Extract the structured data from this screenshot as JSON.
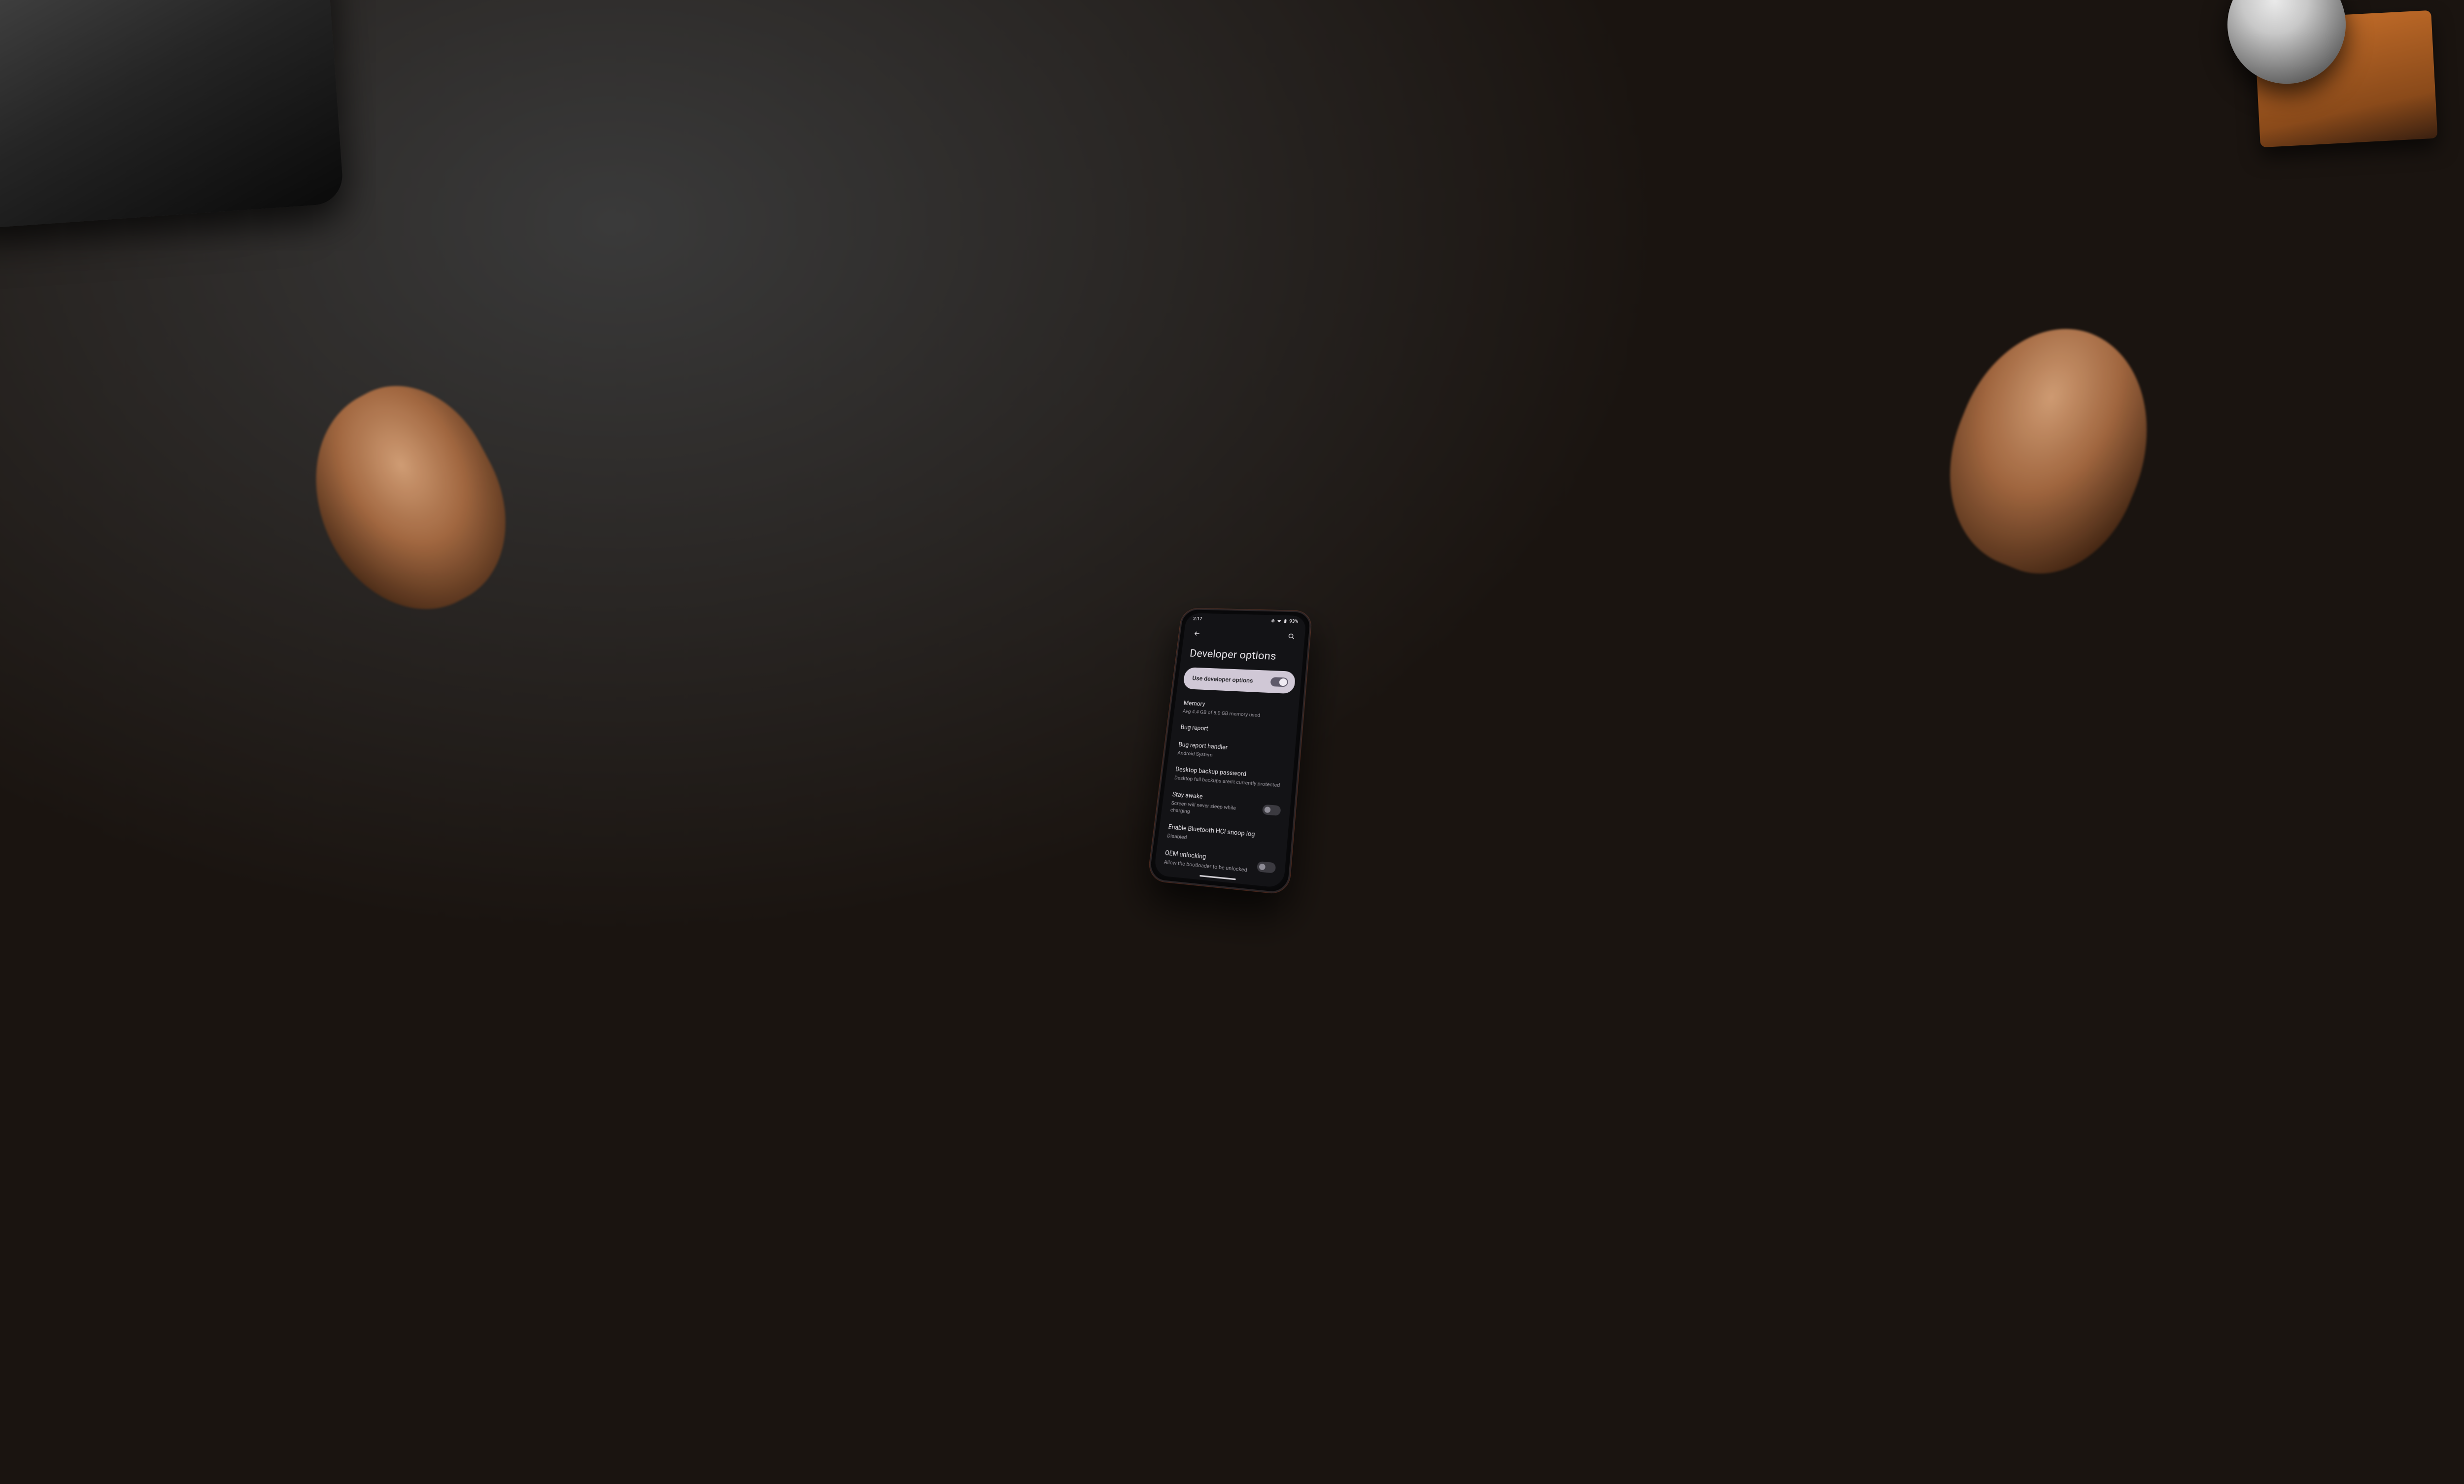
{
  "status": {
    "time": "2:17",
    "battery": "93%"
  },
  "page": {
    "title": "Developer options"
  },
  "master": {
    "label": "Use developer options",
    "on": true
  },
  "rows": [
    {
      "id": "memory",
      "title": "Memory",
      "sub": "Avg 4.4 GB of 8.0 GB memory used",
      "toggle": null
    },
    {
      "id": "bug-report",
      "title": "Bug report",
      "sub": "",
      "toggle": null
    },
    {
      "id": "bug-handler",
      "title": "Bug report handler",
      "sub": "Android System",
      "toggle": null
    },
    {
      "id": "desktop-backup",
      "title": "Desktop backup password",
      "sub": "Desktop full backups aren't currently protected",
      "toggle": null
    },
    {
      "id": "stay-awake",
      "title": "Stay awake",
      "sub": "Screen will never sleep while charging",
      "toggle": false
    },
    {
      "id": "bt-hci",
      "title": "Enable Bluetooth HCI snoop log",
      "sub": "Disabled",
      "toggle": null
    },
    {
      "id": "oem-unlock",
      "title": "OEM unlocking",
      "sub": "Allow the bootloader to be unlocked",
      "toggle": false
    }
  ]
}
